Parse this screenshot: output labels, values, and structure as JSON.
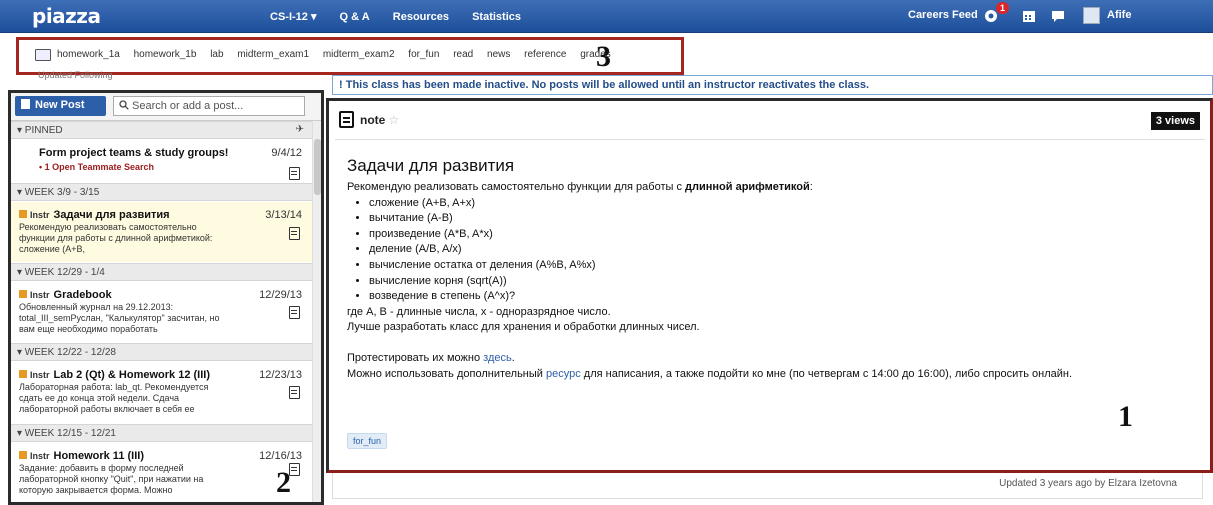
{
  "topbar": {
    "logo": "piazza",
    "nav": [
      "CS-I-12 ▾",
      "Q & A",
      "Resources",
      "Statistics"
    ],
    "careers": "Careers Feed",
    "notification_count": "1",
    "user": "Afife"
  },
  "folders": {
    "items": [
      "homework_1a",
      "homework_1b",
      "lab",
      "midterm_exam1",
      "midterm_exam2",
      "for_fun",
      "read",
      "news",
      "reference",
      "grades"
    ],
    "updated_line": "Updated   Following"
  },
  "labels": {
    "one": "1",
    "two": "2",
    "three": "3"
  },
  "banner": "! This class has been made inactive. No posts will be allowed until an instructor reactivates the class.",
  "feed": {
    "new_post": "New Post",
    "search_placeholder": "Search or add a post...",
    "pinned": "▾ PINNED",
    "groups": [
      "▾ WEEK 3/9 - 3/15",
      "▾ WEEK 12/29 - 1/4",
      "▾ WEEK 12/22 - 12/28",
      "▾ WEEK 12/15 - 12/21"
    ],
    "instr": "Instr",
    "posts": [
      {
        "title": "Form project teams & study groups!",
        "date": "9/4/12",
        "sub": "• 1 Open Teammate Search",
        "snippet": ""
      },
      {
        "title": "Задачи для развития",
        "date": "3/13/14",
        "snippet": "Рекомендую реализовать самостоятельно функции для работы с длинной арифметикой: сложение (A+B,"
      },
      {
        "title": "Gradebook",
        "date": "12/29/13",
        "snippet": "Обновленный журнал на 29.12.2013: total_III_semРуслан, \"Калькулятор\" засчитан, но вам еще необходимо поработать"
      },
      {
        "title": "Lab 2 (Qt) & Homework 12 (III)",
        "date": "12/23/13",
        "snippet": "Лабораторная работа: lab_qt.  Рекомендуется сдать ее до конца этой недели. Сдача лабораторной работы включает в себя ее"
      },
      {
        "title": "Homework 11 (III)",
        "date": "12/16/13",
        "snippet": "Задание: добавить в форму последней лабораторной кнопку \"Quit\", при нажатии на которую закрывается форма.  Можно"
      }
    ]
  },
  "note": {
    "type": "note",
    "views": "3 views",
    "title": "Задачи для развития",
    "intro_plain": "Рекомендую реализовать самостоятельно функции для работы с ",
    "intro_bold": "длинной арифметикой",
    "intro_end": ":",
    "bullets": [
      "сложение (A+B, A+x)",
      "вычитание (A-B)",
      "произведение (A*B, A*x)",
      "деление (A/B, A/x)",
      "вычисление остатка от деления (A%B, A%x)",
      "вычисление корня (sqrt(A))",
      "возведение в степень (A^x)?"
    ],
    "line1": "где A, B - длинные числа, x - одноразрядное число.",
    "line2": "Лучше разработать класс для хранения и обработки длинных чисел.",
    "test_prefix": "Протестировать их можно ",
    "test_link": "здесь",
    "test_suffix": ".",
    "res_prefix": "Можно использовать дополнительный ",
    "res_link": "ресурс",
    "res_suffix": " для написания, а также подойти ко мне (по четвергам с 14:00 до 16:00), либо спросить онлайн.",
    "tag": "for_fun",
    "updated": "Updated 3 years ago by Elzara Izetovna"
  }
}
